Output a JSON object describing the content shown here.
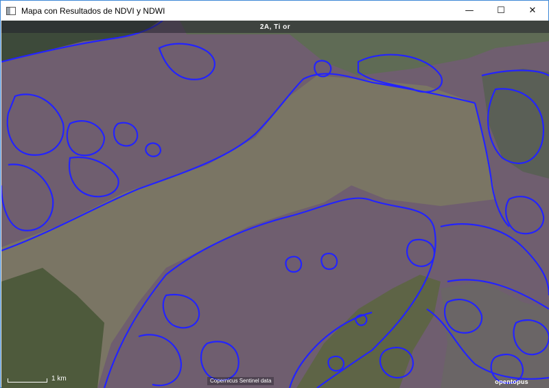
{
  "window": {
    "title": "Mapa con Resultados de NDVI y NDWI",
    "minimize_glyph": "—",
    "maximize_glyph": "☐",
    "close_glyph": "✕"
  },
  "map": {
    "header_label": "2A, Ti   or",
    "scale_label": "1 km",
    "attribution": "Copernicus Sentinel data",
    "logo": "opentopus",
    "outline_color": "#2222ff",
    "water_color": "#6f5e6f",
    "land_color": "#6b6a55"
  }
}
